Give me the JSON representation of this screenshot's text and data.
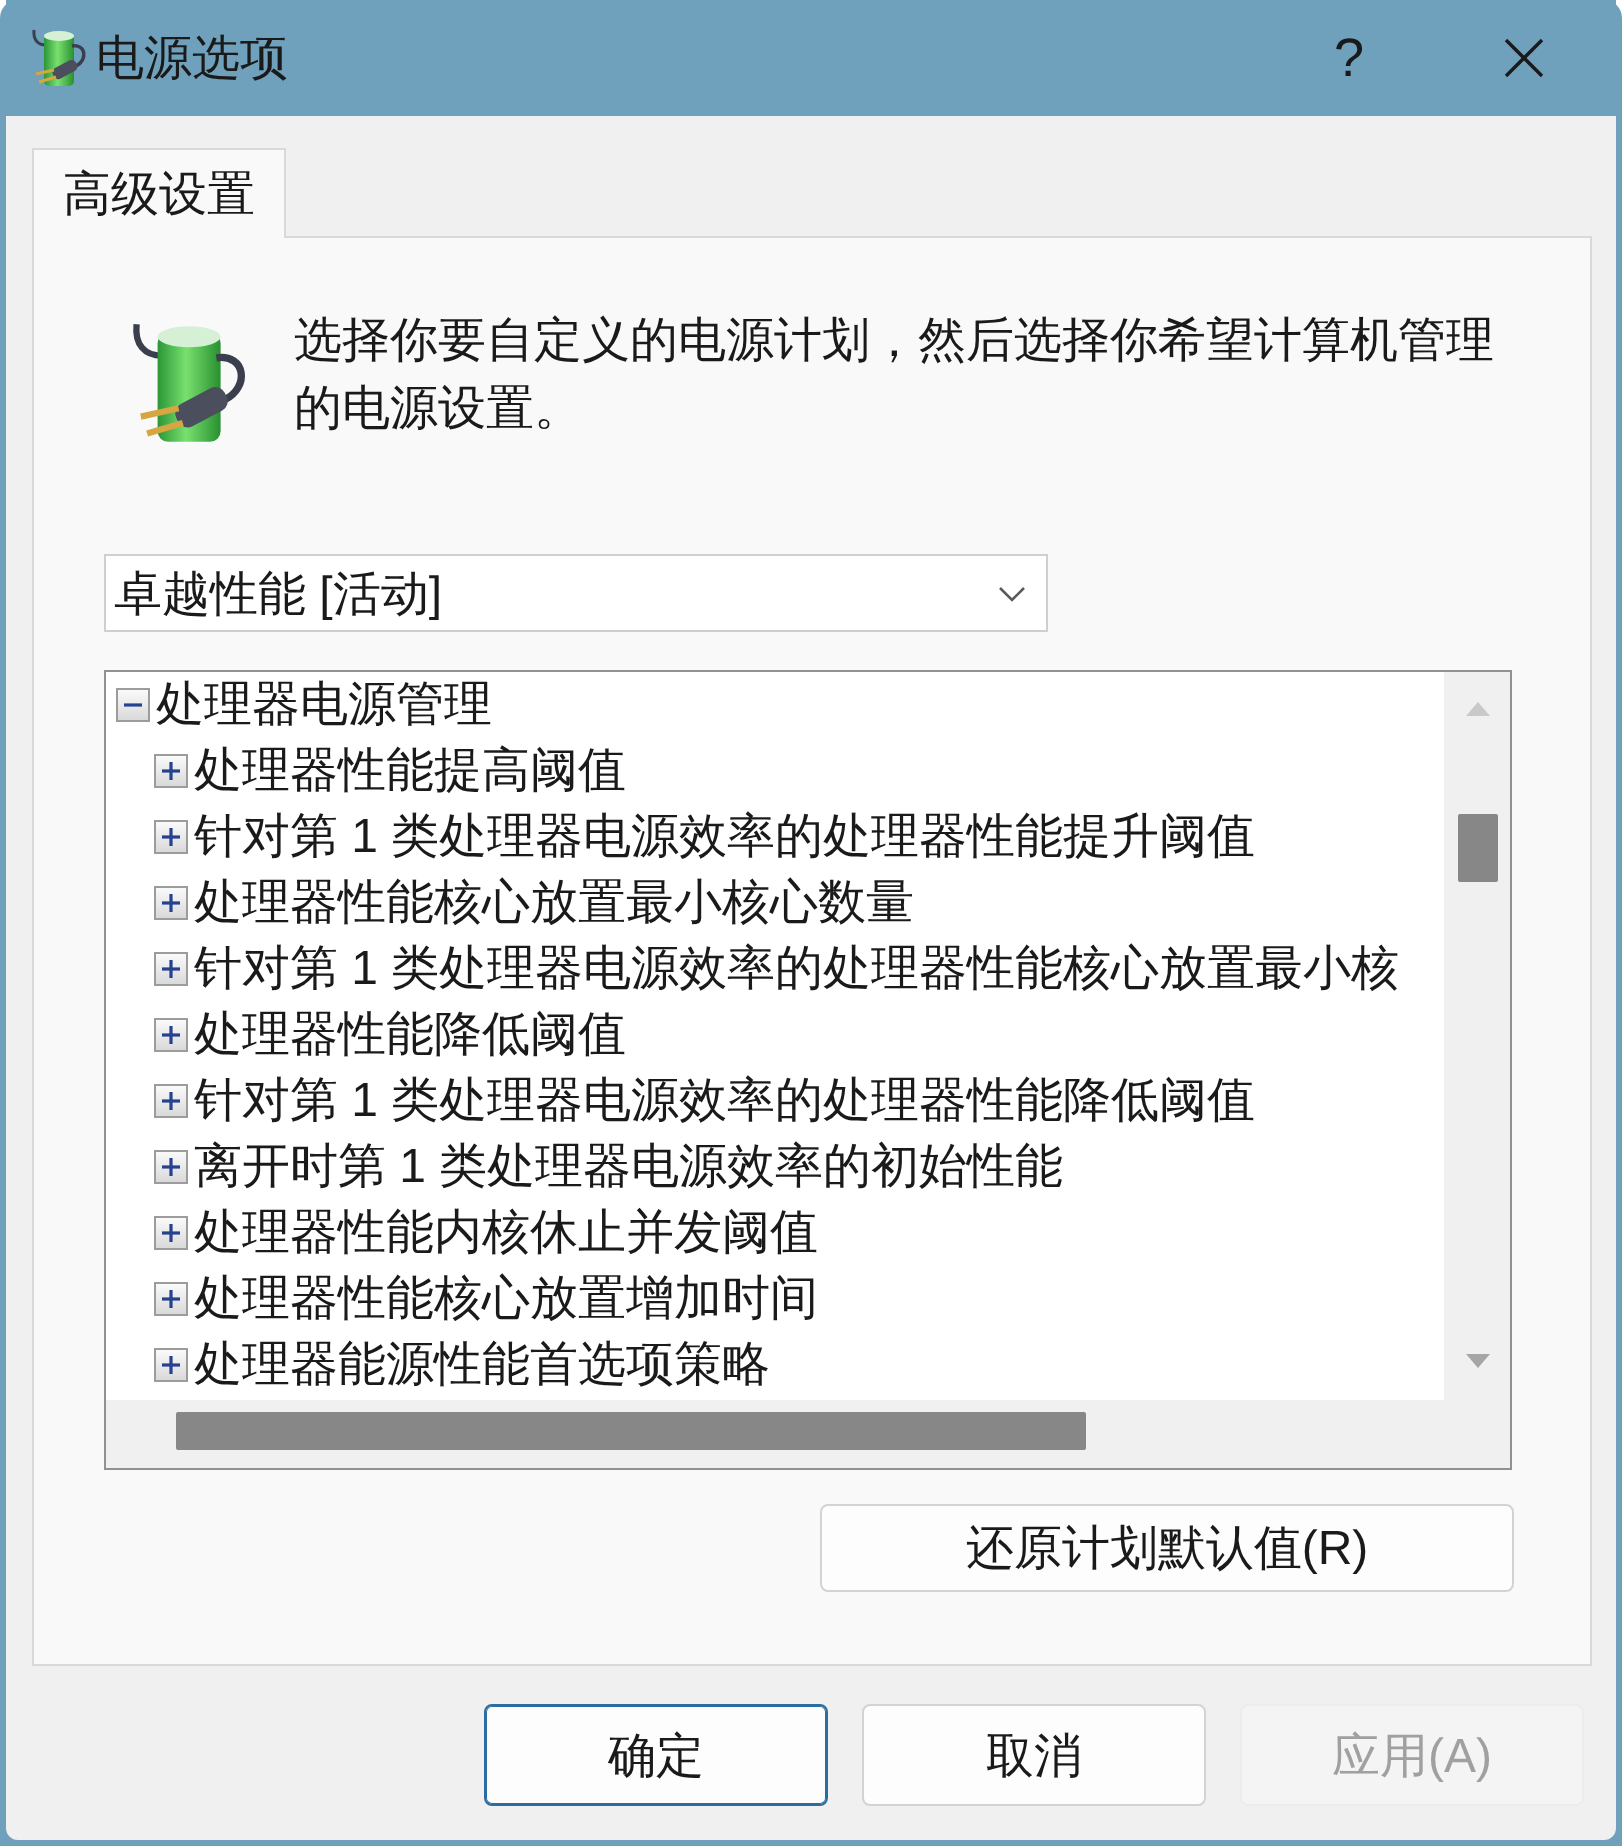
{
  "window": {
    "title": "电源选项",
    "help_label": "?"
  },
  "tabs": [
    {
      "label": "高级设置",
      "selected": true
    }
  ],
  "description": "选择你要自定义的电源计划，然后选择你希望计算机管理的电源设置。",
  "plan_dropdown": {
    "value": "卓越性能 [活动]"
  },
  "settings_tree": [
    {
      "label": "处理器电源管理",
      "expanded": true,
      "children": [
        {
          "label": "处理器性能提高阈值",
          "expanded": false
        },
        {
          "label": "针对第 1 类处理器电源效率的处理器性能提升阈值",
          "expanded": false
        },
        {
          "label": "处理器性能核心放置最小核心数量",
          "expanded": false
        },
        {
          "label": "针对第 1 类处理器电源效率的处理器性能核心放置最小核",
          "expanded": false
        },
        {
          "label": "处理器性能降低阈值",
          "expanded": false
        },
        {
          "label": "针对第 1 类处理器电源效率的处理器性能降低阈值",
          "expanded": false
        },
        {
          "label": "离开时第 1 类处理器电源效率的初始性能",
          "expanded": false
        },
        {
          "label": "处理器性能内核休止并发阈值",
          "expanded": false
        },
        {
          "label": "处理器性能核心放置增加时间",
          "expanded": false
        },
        {
          "label": "处理器能源性能首选项策略",
          "expanded": false
        }
      ]
    }
  ],
  "restore_button": {
    "label": "还原计划默认值(R)"
  },
  "buttons": [
    {
      "label": "确定",
      "focused": true,
      "disabled": false
    },
    {
      "label": "取消",
      "focused": false,
      "disabled": false
    },
    {
      "label": "应用(A)",
      "focused": false,
      "disabled": true
    }
  ]
}
